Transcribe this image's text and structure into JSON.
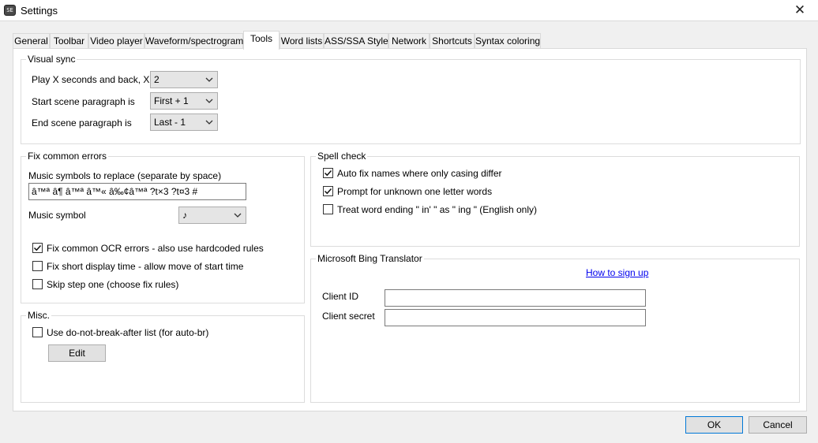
{
  "window": {
    "title": "Settings",
    "icon_text": "SE"
  },
  "tabs": [
    {
      "label": "General"
    },
    {
      "label": "Toolbar"
    },
    {
      "label": "Video player"
    },
    {
      "label": "Waveform/spectrogram"
    },
    {
      "label": "Tools"
    },
    {
      "label": "Word lists"
    },
    {
      "label": "ASS/SSA Style"
    },
    {
      "label": "Network"
    },
    {
      "label": "Shortcuts"
    },
    {
      "label": "Syntax coloring"
    }
  ],
  "visual_sync": {
    "title": "Visual sync",
    "play_label": "Play X seconds and back, X is",
    "play_value": "2",
    "start_label": "Start scene paragraph is",
    "start_value": "First + 1",
    "end_label": "End scene paragraph is",
    "end_value": "Last - 1"
  },
  "fix_common_errors": {
    "title": "Fix common errors",
    "music_symbols_label": "Music symbols to replace (separate by space)",
    "music_symbols_value": "â™ª â¶ â™ª â™« â‰¢â™ª ?t×3 ?t¤3 #",
    "music_symbol_label": "Music symbol",
    "music_symbol_value": "♪",
    "ocr_label": "Fix common OCR errors - also use hardcoded rules",
    "ocr_checked": true,
    "short_label": "Fix short display time - allow move of start time",
    "short_checked": false,
    "skip_label": "Skip step one (choose fix rules)",
    "skip_checked": false
  },
  "misc": {
    "title": "Misc.",
    "dnb_label": "Use do-not-break-after list (for auto-br)",
    "dnb_checked": false,
    "edit_label": "Edit"
  },
  "spell_check": {
    "title": "Spell check",
    "autofix_label": "Auto fix names where only casing differ",
    "autofix_checked": true,
    "prompt_label": "Prompt for unknown one letter words",
    "prompt_checked": true,
    "treat_label": "Treat word ending \" in' \" as \" ing \" (English only)",
    "treat_checked": false
  },
  "bing": {
    "title": "Microsoft Bing Translator",
    "signup_link": "How to sign up",
    "client_id_label": "Client ID",
    "client_id_value": "",
    "client_secret_label": "Client secret",
    "client_secret_value": ""
  },
  "footer": {
    "ok_label": "OK",
    "cancel_label": "Cancel"
  }
}
